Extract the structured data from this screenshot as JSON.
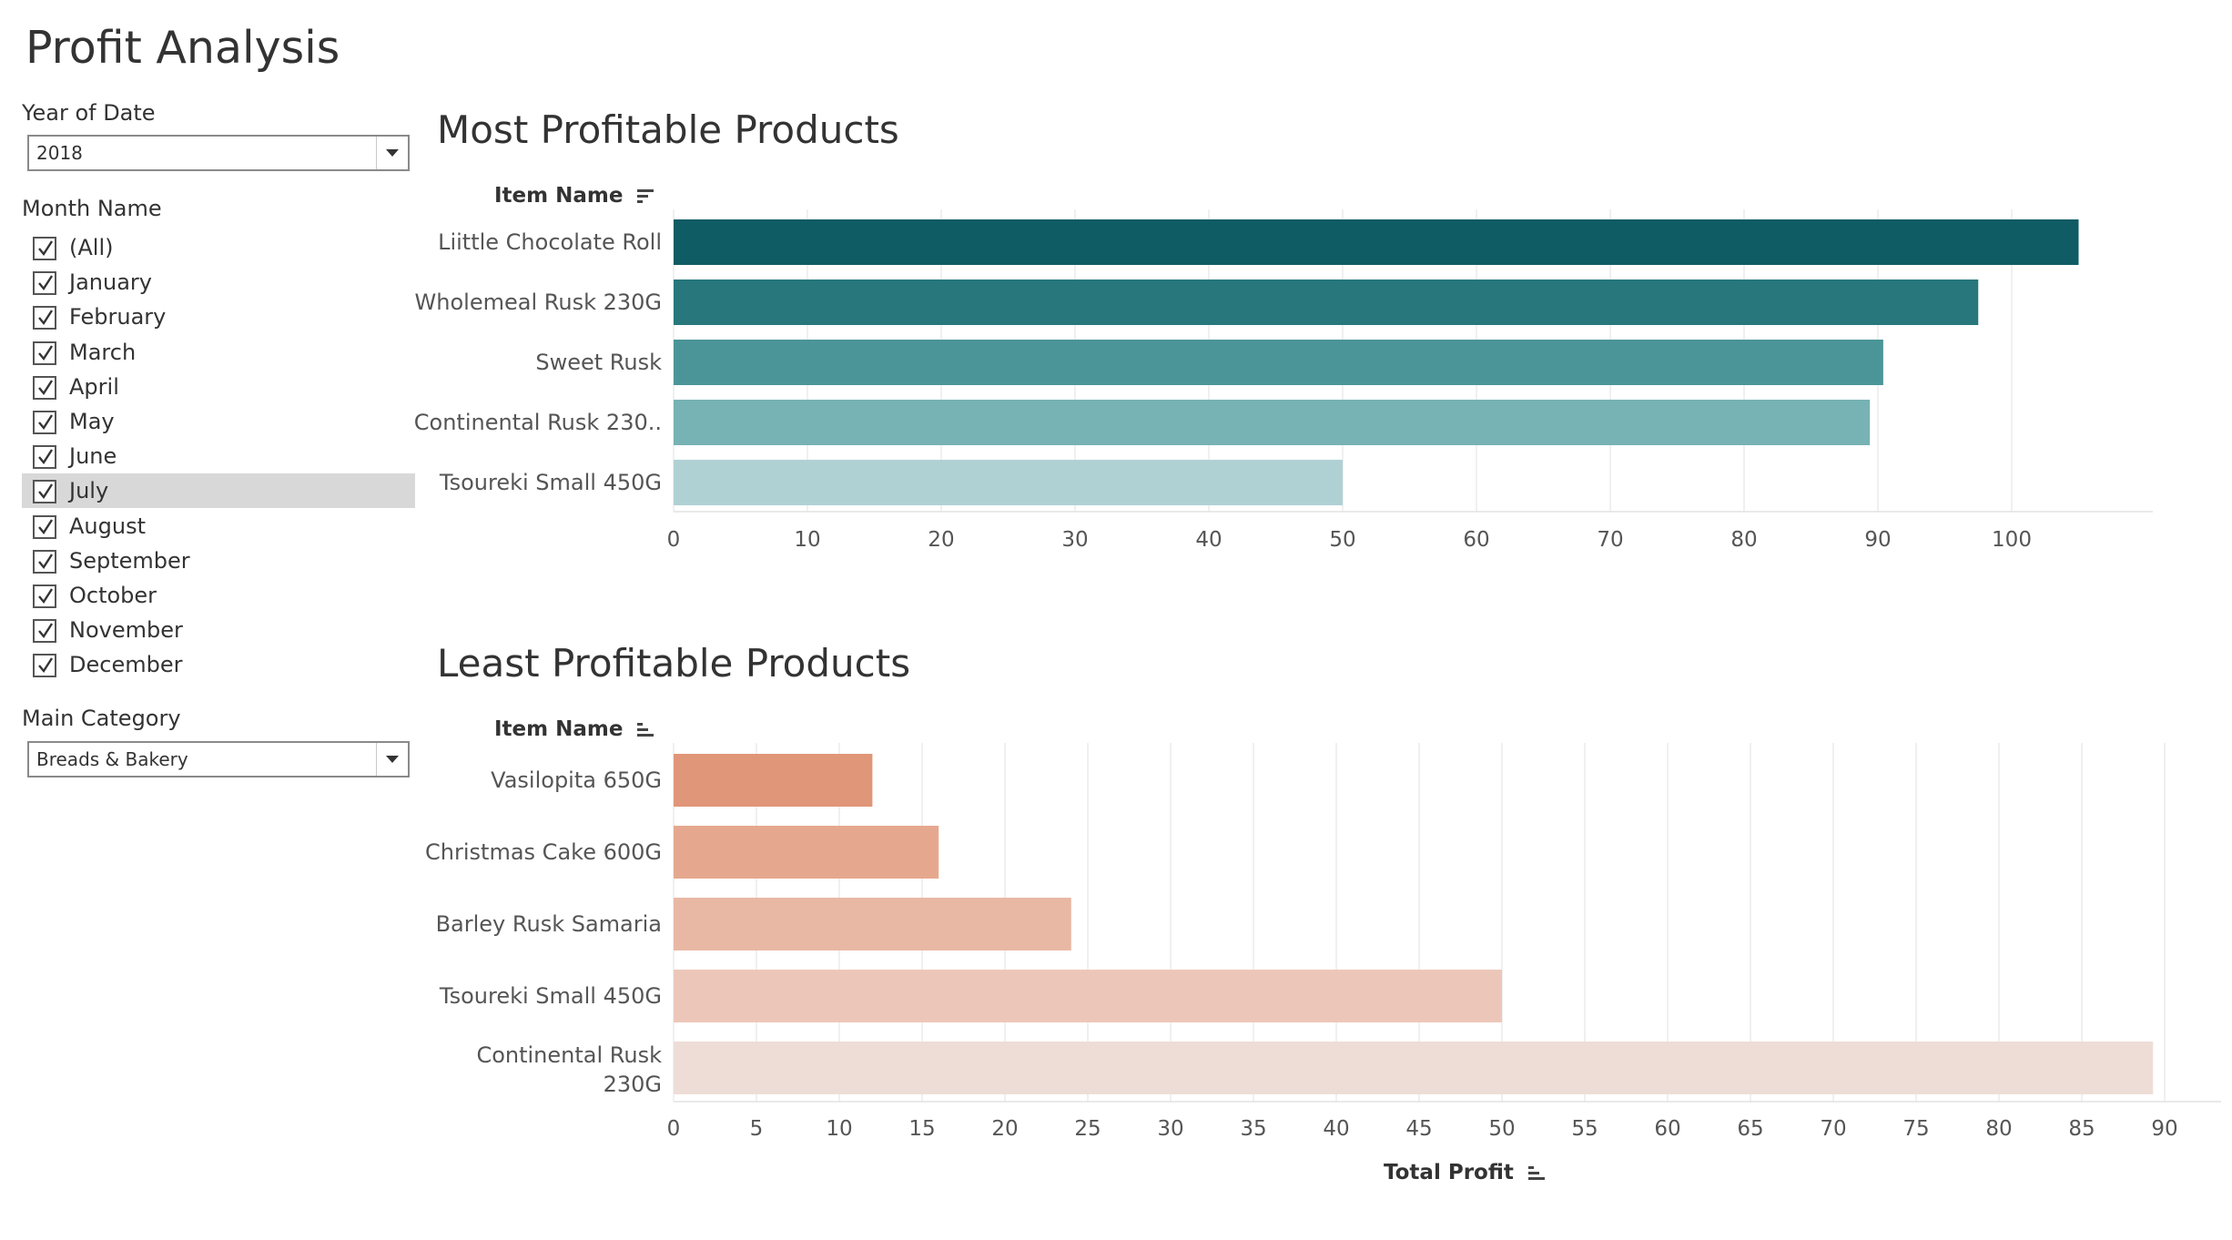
{
  "page": {
    "title": "Profit Analysis"
  },
  "filters": {
    "year": {
      "label": "Year of Date",
      "value": "2018"
    },
    "month": {
      "label": "Month Name",
      "items": [
        {
          "label": "(All)",
          "checked": true
        },
        {
          "label": "January",
          "checked": true
        },
        {
          "label": "February",
          "checked": true
        },
        {
          "label": "March",
          "checked": true
        },
        {
          "label": "April",
          "checked": true
        },
        {
          "label": "May",
          "checked": true
        },
        {
          "label": "June",
          "checked": true
        },
        {
          "label": "July",
          "checked": true,
          "highlighted": true
        },
        {
          "label": "August",
          "checked": true
        },
        {
          "label": "September",
          "checked": true
        },
        {
          "label": "October",
          "checked": true
        },
        {
          "label": "November",
          "checked": true
        },
        {
          "label": "December",
          "checked": true
        }
      ]
    },
    "category": {
      "label": "Main Category",
      "value": "Breads & Bakery"
    }
  },
  "chart_data": [
    {
      "type": "bar",
      "orientation": "horizontal",
      "title": "Most Profitable Products",
      "ylabel": "Item Name",
      "xlabel": "",
      "categories": [
        "Liittle Chocolate Roll",
        "Wholemeal Rusk 230G",
        "Sweet Rusk",
        "Continental Rusk 230..",
        "Tsoureki Small 450G"
      ],
      "values": [
        105,
        97.5,
        90.4,
        89.4,
        50
      ],
      "colors": [
        "#0f5c64",
        "#27777c",
        "#4b9598",
        "#77b2b5",
        "#b0d1d4"
      ],
      "xlim": [
        0,
        110
      ],
      "xticks": [
        "0",
        "10",
        "20",
        "30",
        "40",
        "50",
        "60",
        "70",
        "80",
        "90",
        "100"
      ],
      "grid": true
    },
    {
      "type": "bar",
      "orientation": "horizontal",
      "title": "Least Profitable Products",
      "ylabel": "Item Name",
      "xlabel": "Total Profit",
      "categories": [
        "Vasilopita 650G",
        "Christmas Cake 600G",
        "Barley Rusk Samaria",
        "Tsoureki Small 450G",
        "Continental Rusk 230G"
      ],
      "values": [
        12,
        16,
        24,
        50,
        89.3
      ],
      "colors": [
        "#e09678",
        "#e5a88f",
        "#e9b8a5",
        "#ecc7b9",
        "#eeddd7"
      ],
      "xlim": [
        0,
        92
      ],
      "xticks": [
        "0",
        "5",
        "10",
        "15",
        "20",
        "25",
        "30",
        "35",
        "40",
        "45",
        "50",
        "55",
        "60",
        "65",
        "70",
        "75",
        "80",
        "85",
        "90"
      ],
      "grid": true
    }
  ]
}
